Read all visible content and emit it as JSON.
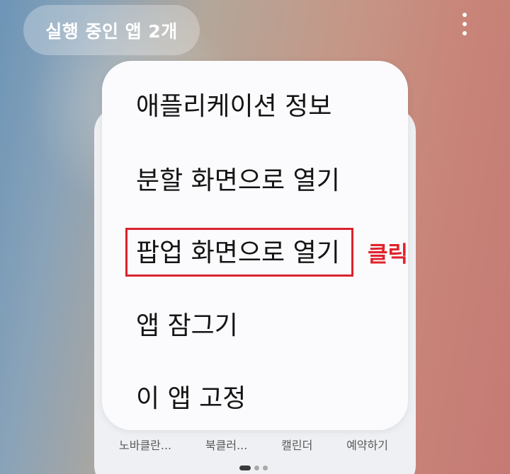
{
  "header": {
    "running_apps_label": "실행 중인 앱 2개",
    "more_icon": "more-vertical-icon"
  },
  "background_card": {
    "shortcut_labels": [
      "노바클란...",
      "북클러...",
      "캘린더",
      "예약하기"
    ],
    "pager": {
      "active_index": 0,
      "count": 3
    }
  },
  "context_menu": {
    "items": [
      {
        "label": "애플리케이션 정보"
      },
      {
        "label": "분할 화면으로 열기"
      },
      {
        "label": "팝업 화면으로 열기"
      },
      {
        "label": "앱 잠그기"
      },
      {
        "label": "이 앱 고정"
      }
    ]
  },
  "annotation": {
    "label": "클릭",
    "color": "#d9232d",
    "target_item_index": 2
  }
}
